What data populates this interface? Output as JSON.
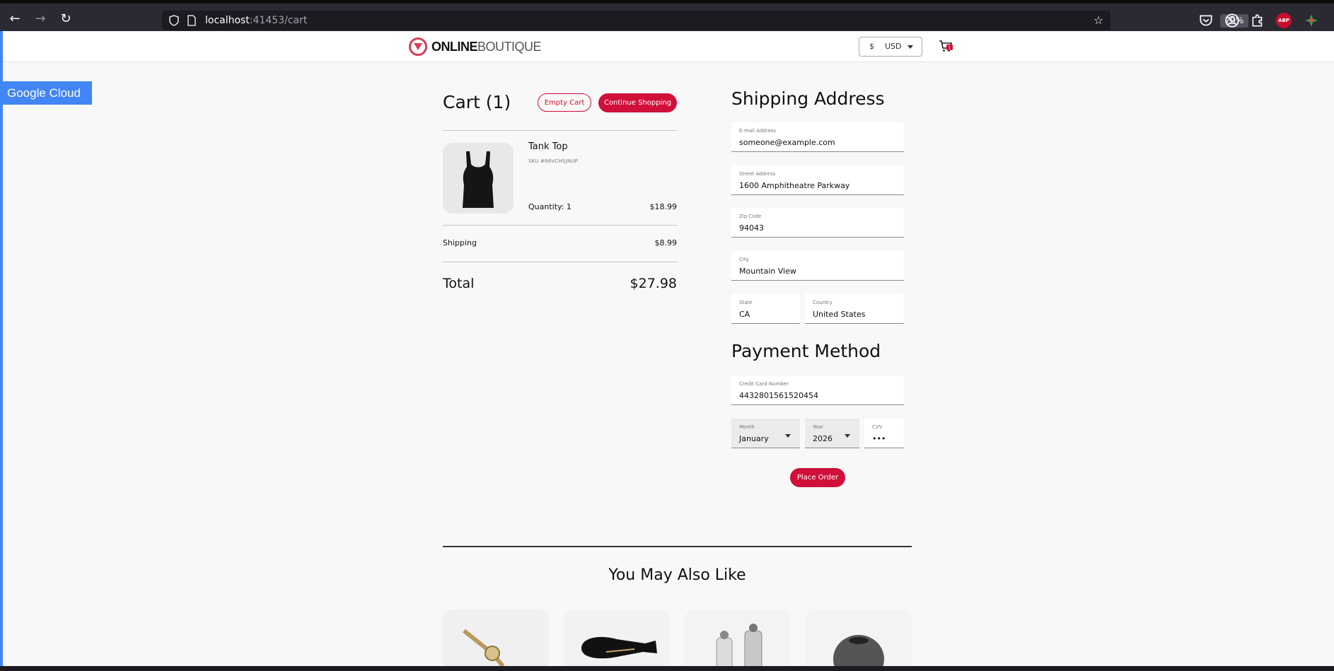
{
  "browser": {
    "url_host": "localhost",
    "url_rest": ":41453/cart",
    "zoom": "70%"
  },
  "header": {
    "logo_online": "ONLINE",
    "logo_boutique": "BOUTIQUE",
    "currency_symbol": "$",
    "currency_code": "USD"
  },
  "banner": {
    "label": "Google Cloud"
  },
  "cart": {
    "title": "Cart (1)",
    "empty_label": "Empty Cart",
    "continue_label": "Continue Shopping",
    "item": {
      "name": "Tank Top",
      "sku": "SKU #66VCHSJNUP",
      "quantity": "Quantity: 1",
      "price": "$18.99"
    },
    "shipping_label": "Shipping",
    "shipping_value": "$8.99",
    "total_label": "Total",
    "total_value": "$27.98"
  },
  "shipping": {
    "title": "Shipping Address",
    "email": {
      "label": "E-mail Address",
      "value": "someone@example.com"
    },
    "street": {
      "label": "Street Address",
      "value": "1600 Amphitheatre Parkway"
    },
    "zip": {
      "label": "Zip Code",
      "value": "94043"
    },
    "city": {
      "label": "City",
      "value": "Mountain View"
    },
    "state": {
      "label": "State",
      "value": "CA"
    },
    "country": {
      "label": "Country",
      "value": "United States"
    }
  },
  "payment": {
    "title": "Payment Method",
    "card": {
      "label": "Credit Card Number",
      "value": "4432801561520454"
    },
    "month": {
      "label": "Month",
      "value": "January"
    },
    "year": {
      "label": "Year",
      "value": "2026"
    },
    "cvv": {
      "label": "CVV",
      "value": "•••"
    },
    "place_order_label": "Place Order"
  },
  "recommendations": {
    "title": "You May Also Like",
    "items": [
      "watch",
      "hair-dryer",
      "salt-and-pepper-shakers",
      "candle-holder"
    ]
  },
  "colors": {
    "brand_red": "#d0103a",
    "google_blue": "#4285f4"
  }
}
